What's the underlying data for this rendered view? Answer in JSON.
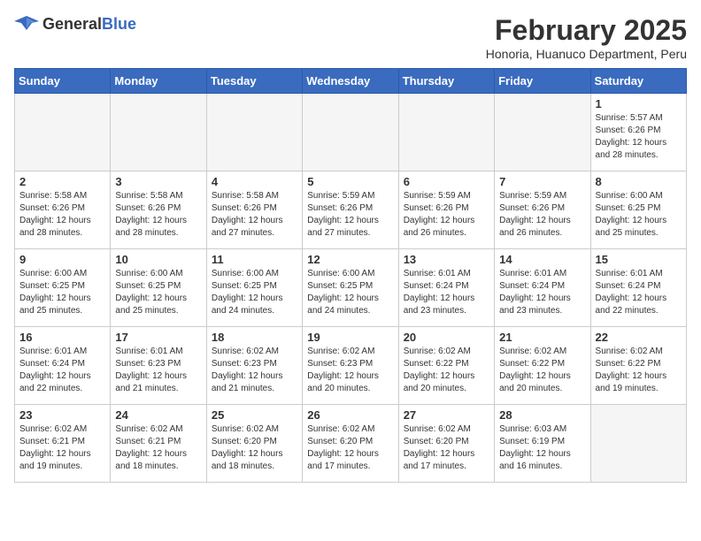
{
  "logo": {
    "general": "General",
    "blue": "Blue"
  },
  "header": {
    "title": "February 2025",
    "subtitle": "Honoria, Huanuco Department, Peru"
  },
  "weekdays": [
    "Sunday",
    "Monday",
    "Tuesday",
    "Wednesday",
    "Thursday",
    "Friday",
    "Saturday"
  ],
  "weeks": [
    [
      {
        "day": "",
        "info": ""
      },
      {
        "day": "",
        "info": ""
      },
      {
        "day": "",
        "info": ""
      },
      {
        "day": "",
        "info": ""
      },
      {
        "day": "",
        "info": ""
      },
      {
        "day": "",
        "info": ""
      },
      {
        "day": "1",
        "info": "Sunrise: 5:57 AM\nSunset: 6:26 PM\nDaylight: 12 hours and 28 minutes."
      }
    ],
    [
      {
        "day": "2",
        "info": "Sunrise: 5:58 AM\nSunset: 6:26 PM\nDaylight: 12 hours and 28 minutes."
      },
      {
        "day": "3",
        "info": "Sunrise: 5:58 AM\nSunset: 6:26 PM\nDaylight: 12 hours and 28 minutes."
      },
      {
        "day": "4",
        "info": "Sunrise: 5:58 AM\nSunset: 6:26 PM\nDaylight: 12 hours and 27 minutes."
      },
      {
        "day": "5",
        "info": "Sunrise: 5:59 AM\nSunset: 6:26 PM\nDaylight: 12 hours and 27 minutes."
      },
      {
        "day": "6",
        "info": "Sunrise: 5:59 AM\nSunset: 6:26 PM\nDaylight: 12 hours and 26 minutes."
      },
      {
        "day": "7",
        "info": "Sunrise: 5:59 AM\nSunset: 6:26 PM\nDaylight: 12 hours and 26 minutes."
      },
      {
        "day": "8",
        "info": "Sunrise: 6:00 AM\nSunset: 6:25 PM\nDaylight: 12 hours and 25 minutes."
      }
    ],
    [
      {
        "day": "9",
        "info": "Sunrise: 6:00 AM\nSunset: 6:25 PM\nDaylight: 12 hours and 25 minutes."
      },
      {
        "day": "10",
        "info": "Sunrise: 6:00 AM\nSunset: 6:25 PM\nDaylight: 12 hours and 25 minutes."
      },
      {
        "day": "11",
        "info": "Sunrise: 6:00 AM\nSunset: 6:25 PM\nDaylight: 12 hours and 24 minutes."
      },
      {
        "day": "12",
        "info": "Sunrise: 6:00 AM\nSunset: 6:25 PM\nDaylight: 12 hours and 24 minutes."
      },
      {
        "day": "13",
        "info": "Sunrise: 6:01 AM\nSunset: 6:24 PM\nDaylight: 12 hours and 23 minutes."
      },
      {
        "day": "14",
        "info": "Sunrise: 6:01 AM\nSunset: 6:24 PM\nDaylight: 12 hours and 23 minutes."
      },
      {
        "day": "15",
        "info": "Sunrise: 6:01 AM\nSunset: 6:24 PM\nDaylight: 12 hours and 22 minutes."
      }
    ],
    [
      {
        "day": "16",
        "info": "Sunrise: 6:01 AM\nSunset: 6:24 PM\nDaylight: 12 hours and 22 minutes."
      },
      {
        "day": "17",
        "info": "Sunrise: 6:01 AM\nSunset: 6:23 PM\nDaylight: 12 hours and 21 minutes."
      },
      {
        "day": "18",
        "info": "Sunrise: 6:02 AM\nSunset: 6:23 PM\nDaylight: 12 hours and 21 minutes."
      },
      {
        "day": "19",
        "info": "Sunrise: 6:02 AM\nSunset: 6:23 PM\nDaylight: 12 hours and 20 minutes."
      },
      {
        "day": "20",
        "info": "Sunrise: 6:02 AM\nSunset: 6:22 PM\nDaylight: 12 hours and 20 minutes."
      },
      {
        "day": "21",
        "info": "Sunrise: 6:02 AM\nSunset: 6:22 PM\nDaylight: 12 hours and 20 minutes."
      },
      {
        "day": "22",
        "info": "Sunrise: 6:02 AM\nSunset: 6:22 PM\nDaylight: 12 hours and 19 minutes."
      }
    ],
    [
      {
        "day": "23",
        "info": "Sunrise: 6:02 AM\nSunset: 6:21 PM\nDaylight: 12 hours and 19 minutes."
      },
      {
        "day": "24",
        "info": "Sunrise: 6:02 AM\nSunset: 6:21 PM\nDaylight: 12 hours and 18 minutes."
      },
      {
        "day": "25",
        "info": "Sunrise: 6:02 AM\nSunset: 6:20 PM\nDaylight: 12 hours and 18 minutes."
      },
      {
        "day": "26",
        "info": "Sunrise: 6:02 AM\nSunset: 6:20 PM\nDaylight: 12 hours and 17 minutes."
      },
      {
        "day": "27",
        "info": "Sunrise: 6:02 AM\nSunset: 6:20 PM\nDaylight: 12 hours and 17 minutes."
      },
      {
        "day": "28",
        "info": "Sunrise: 6:03 AM\nSunset: 6:19 PM\nDaylight: 12 hours and 16 minutes."
      },
      {
        "day": "",
        "info": ""
      }
    ]
  ]
}
